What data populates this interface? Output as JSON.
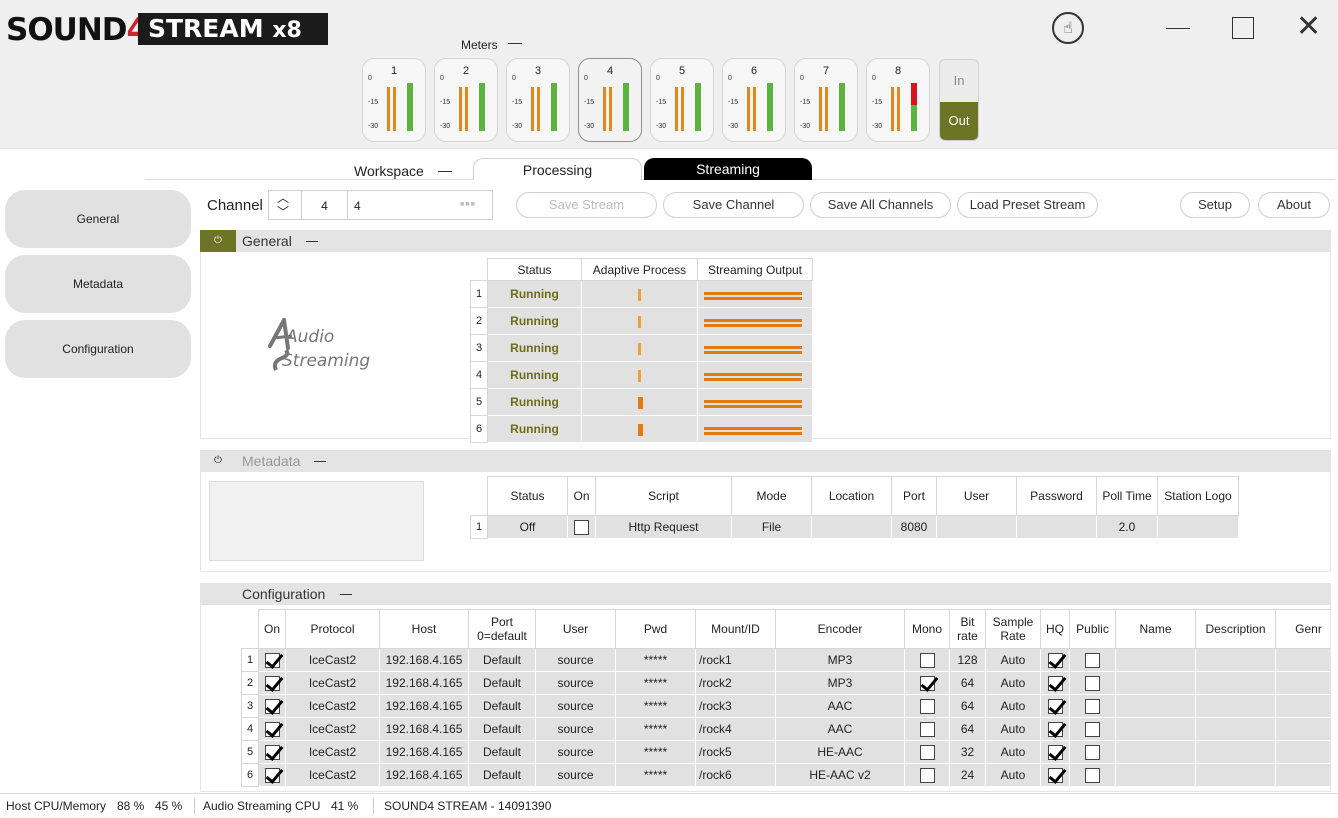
{
  "app": {
    "logo_sound": "SOUND",
    "logo_four": "4",
    "logo_stream": "STREAM",
    "logo_x8": "x8"
  },
  "meters": {
    "label": "Meters",
    "channels": [
      "1",
      "2",
      "3",
      "4",
      "5",
      "6",
      "7",
      "8"
    ],
    "scale": [
      "0",
      "-15",
      "-30"
    ],
    "selected": "4",
    "in_label": "In",
    "out_label": "Out"
  },
  "workspace": {
    "label": "Workspace",
    "tabs": [
      {
        "label": "Processing"
      },
      {
        "label": "Streaming"
      }
    ]
  },
  "sidebar": {
    "items": [
      {
        "label": "General"
      },
      {
        "label": "Metadata"
      },
      {
        "label": "Configuration"
      }
    ]
  },
  "toolbar": {
    "channel_label": "Channel",
    "channel_number": "4",
    "channel_name": "4",
    "buttons": [
      "Save Stream",
      "Save Channel",
      "Save All Channels",
      "Load Preset Stream",
      "Setup",
      "About"
    ]
  },
  "general": {
    "title": "General",
    "headers": [
      "Status",
      "Adaptive Process",
      "Streaming Output"
    ],
    "rows": [
      {
        "idx": "1",
        "status": "Running"
      },
      {
        "idx": "2",
        "status": "Running"
      },
      {
        "idx": "3",
        "status": "Running"
      },
      {
        "idx": "4",
        "status": "Running"
      },
      {
        "idx": "5",
        "status": "Running"
      },
      {
        "idx": "6",
        "status": "Running"
      }
    ],
    "logo_line1": "Audio",
    "logo_line2": "Streaming"
  },
  "metadata": {
    "title": "Metadata",
    "headers": [
      "Status",
      "On",
      "Script",
      "Mode",
      "Location",
      "Port",
      "User",
      "Password",
      "Poll Time",
      "Station Logo"
    ],
    "rows": [
      {
        "idx": "1",
        "status": "Off",
        "script": "Http Request",
        "mode": "File",
        "location": "",
        "port": "8080",
        "user": "",
        "password": "",
        "poll": "2.0",
        "logo": ""
      }
    ]
  },
  "configuration": {
    "title": "Configuration",
    "headers": [
      "On",
      "Protocol",
      "Host",
      "Port 0=default",
      "User",
      "Pwd",
      "Mount/ID",
      "Encoder",
      "Mono",
      "Bit rate",
      "Sample Rate",
      "HQ",
      "Public",
      "Name",
      "Description",
      "Genr"
    ],
    "rows": [
      {
        "idx": "1",
        "protocol": "IceCast2",
        "host": "192.168.4.165",
        "port": "Default",
        "user": "source",
        "pwd": "*****",
        "mount": "/rock1",
        "encoder": "MP3",
        "bitrate": "128",
        "rate": "Auto"
      },
      {
        "idx": "2",
        "protocol": "IceCast2",
        "host": "192.168.4.165",
        "port": "Default",
        "user": "source",
        "pwd": "*****",
        "mount": "/rock2",
        "encoder": "MP3",
        "bitrate": "64",
        "rate": "Auto"
      },
      {
        "idx": "3",
        "protocol": "IceCast2",
        "host": "192.168.4.165",
        "port": "Default",
        "user": "source",
        "pwd": "*****",
        "mount": "/rock3",
        "encoder": "AAC",
        "bitrate": "64",
        "rate": "Auto"
      },
      {
        "idx": "4",
        "protocol": "IceCast2",
        "host": "192.168.4.165",
        "port": "Default",
        "user": "source",
        "pwd": "*****",
        "mount": "/rock4",
        "encoder": "AAC",
        "bitrate": "64",
        "rate": "Auto"
      },
      {
        "idx": "5",
        "protocol": "IceCast2",
        "host": "192.168.4.165",
        "port": "Default",
        "user": "source",
        "pwd": "*****",
        "mount": "/rock5",
        "encoder": "HE-AAC",
        "bitrate": "32",
        "rate": "Auto"
      },
      {
        "idx": "6",
        "protocol": "IceCast2",
        "host": "192.168.4.165",
        "port": "Default",
        "user": "source",
        "pwd": "*****",
        "mount": "/rock6",
        "encoder": "HE-AAC v2",
        "bitrate": "24",
        "rate": "Auto"
      }
    ],
    "mono": [
      false,
      true,
      false,
      false,
      false,
      false
    ]
  },
  "status": {
    "host_label": "Host CPU/Memory",
    "host_cpu": "88 %",
    "host_mem": "45 %",
    "as_label": "Audio Streaming CPU",
    "as_cpu": "41 %",
    "product": "SOUND4 STREAM - 14091390"
  },
  "colors": {
    "accent": "#6d7426",
    "orange": "#e07b0e",
    "meter_green": "#5cb33e",
    "clip_red": "#d8151f"
  }
}
